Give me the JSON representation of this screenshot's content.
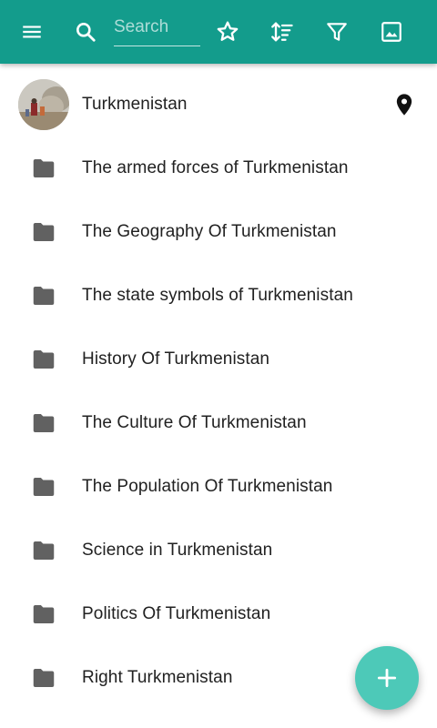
{
  "toolbar": {
    "background": "#139c8c",
    "search_placeholder": "Search",
    "icons": [
      "menu-icon",
      "search-icon",
      "star-outline-icon",
      "sort-icon",
      "filter-icon",
      "image-icon"
    ]
  },
  "list": {
    "header_item": {
      "label": "Turkmenistan",
      "avatar": "photo-thumbnail",
      "action_icon": "map-pin-icon"
    },
    "folders": [
      {
        "label": "The armed forces of Turkmenistan"
      },
      {
        "label": "The Geography Of Turkmenistan"
      },
      {
        "label": "The state symbols of Turkmenistan"
      },
      {
        "label": "History Of Turkmenistan"
      },
      {
        "label": "The Culture Of Turkmenistan"
      },
      {
        "label": "The Population Of Turkmenistan"
      },
      {
        "label": "Science in Turkmenistan"
      },
      {
        "label": "Politics Of Turkmenistan"
      },
      {
        "label": "Right Turkmenistan"
      }
    ],
    "folder_icon": "folder-icon",
    "folder_icon_color": "#616161"
  },
  "fab": {
    "icon": "plus-icon",
    "color": "#4dc9b8"
  }
}
